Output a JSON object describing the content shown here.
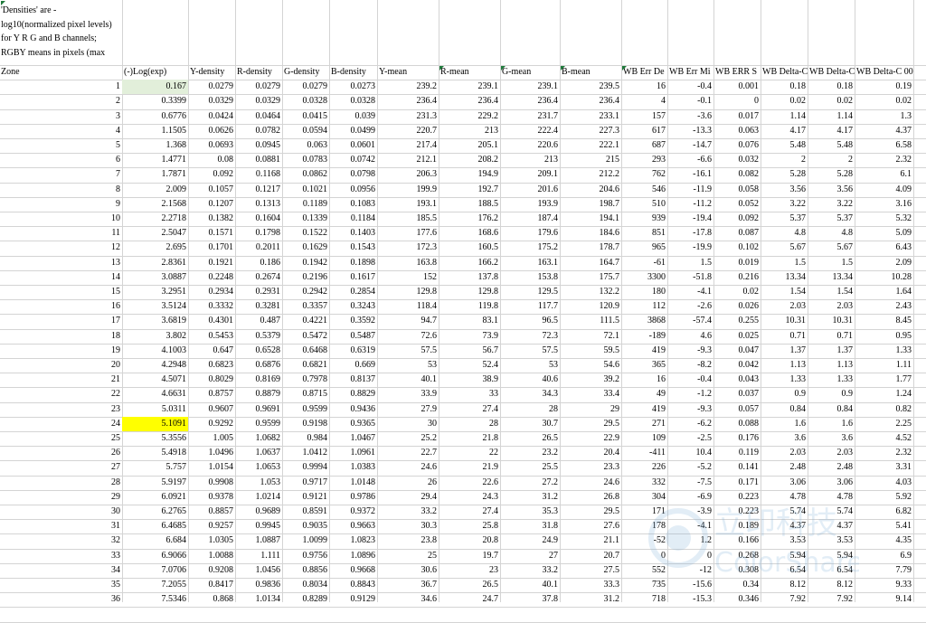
{
  "note_text": "'Densities' are -log10(normalized pixel levels) for Y R G and B channels; RGBY means in pixels (max",
  "zone_header": "Zone",
  "headers": [
    "(-)Log(exp)",
    "Y-density",
    "R-density",
    "G-density",
    "B-density",
    "Y-mean",
    "R-mean",
    "G-mean",
    "B-mean",
    "WB Err De",
    "WB Err Mi",
    "WB ERR S",
    "WB Delta-C",
    "WB Delta-C",
    "WB Delta-C 00"
  ],
  "rows": [
    [
      "1",
      "0.167",
      "0.0279",
      "0.0279",
      "0.0279",
      "0.0273",
      "239.2",
      "239.1",
      "239.1",
      "239.5",
      "16",
      "-0.4",
      "0.001",
      "0.18",
      "0.18",
      "0.19"
    ],
    [
      "2",
      "0.3399",
      "0.0329",
      "0.0329",
      "0.0328",
      "0.0328",
      "236.4",
      "236.4",
      "236.4",
      "236.4",
      "4",
      "-0.1",
      "0",
      "0.02",
      "0.02",
      "0.02"
    ],
    [
      "3",
      "0.6776",
      "0.0424",
      "0.0464",
      "0.0415",
      "0.039",
      "231.3",
      "229.2",
      "231.7",
      "233.1",
      "157",
      "-3.6",
      "0.017",
      "1.14",
      "1.14",
      "1.3"
    ],
    [
      "4",
      "1.1505",
      "0.0626",
      "0.0782",
      "0.0594",
      "0.0499",
      "220.7",
      "213",
      "222.4",
      "227.3",
      "617",
      "-13.3",
      "0.063",
      "4.17",
      "4.17",
      "4.37"
    ],
    [
      "5",
      "1.368",
      "0.0693",
      "0.0945",
      "0.063",
      "0.0601",
      "217.4",
      "205.1",
      "220.6",
      "222.1",
      "687",
      "-14.7",
      "0.076",
      "5.48",
      "5.48",
      "6.58"
    ],
    [
      "6",
      "1.4771",
      "0.08",
      "0.0881",
      "0.0783",
      "0.0742",
      "212.1",
      "208.2",
      "213",
      "215",
      "293",
      "-6.6",
      "0.032",
      "2",
      "2",
      "2.32"
    ],
    [
      "7",
      "1.7871",
      "0.092",
      "0.1168",
      "0.0862",
      "0.0798",
      "206.3",
      "194.9",
      "209.1",
      "212.2",
      "762",
      "-16.1",
      "0.082",
      "5.28",
      "5.28",
      "6.1"
    ],
    [
      "8",
      "2.009",
      "0.1057",
      "0.1217",
      "0.1021",
      "0.0956",
      "199.9",
      "192.7",
      "201.6",
      "204.6",
      "546",
      "-11.9",
      "0.058",
      "3.56",
      "3.56",
      "4.09"
    ],
    [
      "9",
      "2.1568",
      "0.1207",
      "0.1313",
      "0.1189",
      "0.1083",
      "193.1",
      "188.5",
      "193.9",
      "198.7",
      "510",
      "-11.2",
      "0.052",
      "3.22",
      "3.22",
      "3.16"
    ],
    [
      "10",
      "2.2718",
      "0.1382",
      "0.1604",
      "0.1339",
      "0.1184",
      "185.5",
      "176.2",
      "187.4",
      "194.1",
      "939",
      "-19.4",
      "0.092",
      "5.37",
      "5.37",
      "5.32"
    ],
    [
      "11",
      "2.5047",
      "0.1571",
      "0.1798",
      "0.1522",
      "0.1403",
      "177.6",
      "168.6",
      "179.6",
      "184.6",
      "851",
      "-17.8",
      "0.087",
      "4.8",
      "4.8",
      "5.09"
    ],
    [
      "12",
      "2.695",
      "0.1701",
      "0.2011",
      "0.1629",
      "0.1543",
      "172.3",
      "160.5",
      "175.2",
      "178.7",
      "965",
      "-19.9",
      "0.102",
      "5.67",
      "5.67",
      "6.43"
    ],
    [
      "13",
      "2.8361",
      "0.1921",
      "0.186",
      "0.1942",
      "0.1898",
      "163.8",
      "166.2",
      "163.1",
      "164.7",
      "-61",
      "1.5",
      "0.019",
      "1.5",
      "1.5",
      "2.09"
    ],
    [
      "14",
      "3.0887",
      "0.2248",
      "0.2674",
      "0.2196",
      "0.1617",
      "152",
      "137.8",
      "153.8",
      "175.7",
      "3300",
      "-51.8",
      "0.216",
      "13.34",
      "13.34",
      "10.28"
    ],
    [
      "15",
      "3.2951",
      "0.2934",
      "0.2931",
      "0.2942",
      "0.2854",
      "129.8",
      "129.8",
      "129.5",
      "132.2",
      "180",
      "-4.1",
      "0.02",
      "1.54",
      "1.54",
      "1.64"
    ],
    [
      "16",
      "3.5124",
      "0.3332",
      "0.3281",
      "0.3357",
      "0.3243",
      "118.4",
      "119.8",
      "117.7",
      "120.9",
      "112",
      "-2.6",
      "0.026",
      "2.03",
      "2.03",
      "2.43"
    ],
    [
      "17",
      "3.6819",
      "0.4301",
      "0.487",
      "0.4221",
      "0.3592",
      "94.7",
      "83.1",
      "96.5",
      "111.5",
      "3868",
      "-57.4",
      "0.255",
      "10.31",
      "10.31",
      "8.45"
    ],
    [
      "18",
      "3.802",
      "0.5453",
      "0.5379",
      "0.5472",
      "0.5487",
      "72.6",
      "73.9",
      "72.3",
      "72.1",
      "-189",
      "4.6",
      "0.025",
      "0.71",
      "0.71",
      "0.95"
    ],
    [
      "19",
      "4.1003",
      "0.647",
      "0.6528",
      "0.6468",
      "0.6319",
      "57.5",
      "56.7",
      "57.5",
      "59.5",
      "419",
      "-9.3",
      "0.047",
      "1.37",
      "1.37",
      "1.33"
    ],
    [
      "20",
      "4.2948",
      "0.6823",
      "0.6876",
      "0.6821",
      "0.669",
      "53",
      "52.4",
      "53",
      "54.6",
      "365",
      "-8.2",
      "0.042",
      "1.13",
      "1.13",
      "1.11"
    ],
    [
      "21",
      "4.5071",
      "0.8029",
      "0.8169",
      "0.7978",
      "0.8137",
      "40.1",
      "38.9",
      "40.6",
      "39.2",
      "16",
      "-0.4",
      "0.043",
      "1.33",
      "1.33",
      "1.77"
    ],
    [
      "22",
      "4.6631",
      "0.8757",
      "0.8879",
      "0.8715",
      "0.8829",
      "33.9",
      "33",
      "34.3",
      "33.4",
      "49",
      "-1.2",
      "0.037",
      "0.9",
      "0.9",
      "1.24"
    ],
    [
      "23",
      "5.0311",
      "0.9607",
      "0.9691",
      "0.9599",
      "0.9436",
      "27.9",
      "27.4",
      "28",
      "29",
      "419",
      "-9.3",
      "0.057",
      "0.84",
      "0.84",
      "0.82"
    ],
    [
      "24",
      "5.1091",
      "0.9292",
      "0.9599",
      "0.9198",
      "0.9365",
      "30",
      "28",
      "30.7",
      "29.5",
      "271",
      "-6.2",
      "0.088",
      "1.6",
      "1.6",
      "2.25"
    ],
    [
      "25",
      "5.3556",
      "1.005",
      "1.0682",
      "0.984",
      "1.0467",
      "25.2",
      "21.8",
      "26.5",
      "22.9",
      "109",
      "-2.5",
      "0.176",
      "3.6",
      "3.6",
      "4.52"
    ],
    [
      "26",
      "5.4918",
      "1.0496",
      "1.0637",
      "1.0412",
      "1.0961",
      "22.7",
      "22",
      "23.2",
      "20.4",
      "-411",
      "10.4",
      "0.119",
      "2.03",
      "2.03",
      "2.32"
    ],
    [
      "27",
      "5.757",
      "1.0154",
      "1.0653",
      "0.9994",
      "1.0383",
      "24.6",
      "21.9",
      "25.5",
      "23.3",
      "226",
      "-5.2",
      "0.141",
      "2.48",
      "2.48",
      "3.31"
    ],
    [
      "28",
      "5.9197",
      "0.9908",
      "1.053",
      "0.9717",
      "1.0148",
      "26",
      "22.6",
      "27.2",
      "24.6",
      "332",
      "-7.5",
      "0.171",
      "3.06",
      "3.06",
      "4.03"
    ],
    [
      "29",
      "6.0921",
      "0.9378",
      "1.0214",
      "0.9121",
      "0.9786",
      "29.4",
      "24.3",
      "31.2",
      "26.8",
      "304",
      "-6.9",
      "0.223",
      "4.78",
      "4.78",
      "5.92"
    ],
    [
      "30",
      "6.2765",
      "0.8857",
      "0.9689",
      "0.8591",
      "0.9372",
      "33.2",
      "27.4",
      "35.3",
      "29.5",
      "171",
      "-3.9",
      "0.223",
      "5.74",
      "5.74",
      "6.82"
    ],
    [
      "31",
      "6.4685",
      "0.9257",
      "0.9945",
      "0.9035",
      "0.9663",
      "30.3",
      "25.8",
      "31.8",
      "27.6",
      "178",
      "-4.1",
      "0.189",
      "4.37",
      "4.37",
      "5.41"
    ],
    [
      "32",
      "6.684",
      "1.0305",
      "1.0887",
      "1.0099",
      "1.0823",
      "23.8",
      "20.8",
      "24.9",
      "21.1",
      "-52",
      "1.2",
      "0.166",
      "3.53",
      "3.53",
      "4.35"
    ],
    [
      "33",
      "6.9066",
      "1.0088",
      "1.111",
      "0.9756",
      "1.0896",
      "25",
      "19.7",
      "27",
      "20.7",
      "0",
      "0",
      "0.268",
      "5.94",
      "5.94",
      "6.9"
    ],
    [
      "34",
      "7.0706",
      "0.9208",
      "1.0456",
      "0.8856",
      "0.9668",
      "30.6",
      "23",
      "33.2",
      "27.5",
      "552",
      "-12",
      "0.308",
      "6.54",
      "6.54",
      "7.79"
    ],
    [
      "35",
      "7.2055",
      "0.8417",
      "0.9836",
      "0.8034",
      "0.8843",
      "36.7",
      "26.5",
      "40.1",
      "33.3",
      "735",
      "-15.6",
      "0.34",
      "8.12",
      "8.12",
      "9.33"
    ],
    [
      "36",
      "7.5346",
      "0.868",
      "1.0134",
      "0.8289",
      "0.9129",
      "34.6",
      "24.7",
      "37.8",
      "31.2",
      "718",
      "-15.3",
      "0.346",
      "7.92",
      "7.92",
      "9.14"
    ]
  ],
  "highlights": {
    "green_cell": "0.167",
    "yellow_cell": "5.1091",
    "green_color": "#e2efda",
    "yellow_color": "#ffff00"
  },
  "watermark_text": "ColorShare"
}
